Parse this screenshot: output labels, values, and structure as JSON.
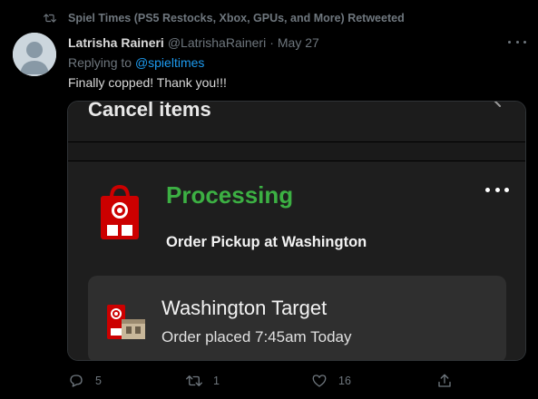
{
  "retweet": {
    "text": "Spiel Times (PS5 Restocks, Xbox, GPUs, and More) Retweeted",
    "icon": "retweet-icon"
  },
  "tweet": {
    "display_name": "Latrisha Raineri",
    "handle": "@LatrishaRaineri",
    "separator": "·",
    "date": "May 27",
    "replying_prefix": "Replying to",
    "replying_to": "@spieltimes",
    "text": "Finally copped! Thank you!!!",
    "more_icon": "more-horizontal-icon"
  },
  "media": {
    "cancel_title": "Cancel items",
    "status": "Processing",
    "pickup": "Order Pickup at Washington",
    "store_name": "Washington Target",
    "order_placed": "Order placed 7:45am Today",
    "status_color": "#3cb043",
    "brand_color": "#cc0000"
  },
  "actions": {
    "reply_count": "5",
    "retweet_count": "1",
    "like_count": "16",
    "share_icon": "share-icon"
  },
  "colors": {
    "background": "#000000",
    "muted": "#6e767d",
    "link": "#1d9bf0",
    "text": "#d9d9d9"
  }
}
